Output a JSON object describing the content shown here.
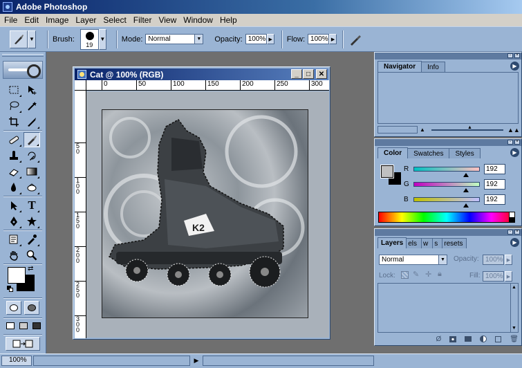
{
  "app": {
    "title": "Adobe Photoshop"
  },
  "menu": [
    "File",
    "Edit",
    "Image",
    "Layer",
    "Select",
    "Filter",
    "View",
    "Window",
    "Help"
  ],
  "options": {
    "brush_label": "Brush:",
    "brush_size": "19",
    "mode_label": "Mode:",
    "mode_value": "Normal",
    "opacity_label": "Opacity:",
    "opacity_value": "100%",
    "flow_label": "Flow:",
    "flow_value": "100%"
  },
  "document": {
    "title": "Cat @ 100% (RGB)",
    "ruler_h": [
      "0",
      "50",
      "100",
      "150",
      "200",
      "250",
      "300"
    ],
    "ruler_v": [
      "5\n0",
      "1\n0\n0",
      "1\n5\n0",
      "2\n0\n0",
      "2\n5\n0",
      "3\n0\n0"
    ]
  },
  "navigator": {
    "tabs": [
      "Navigator",
      "Info"
    ]
  },
  "color": {
    "tabs": [
      "Color",
      "Swatches",
      "Styles"
    ],
    "channels": [
      {
        "label": "R",
        "value": "192",
        "level": 0.75
      },
      {
        "label": "G",
        "value": "192",
        "level": 0.75
      },
      {
        "label": "B",
        "value": "192",
        "level": 0.75
      }
    ],
    "foreground": "#c0c0c0",
    "background": "#000000"
  },
  "layers": {
    "tabs": [
      "Layers",
      "els",
      "w",
      "s",
      "resets"
    ],
    "blend_mode": "Normal",
    "opacity_label": "Opacity:",
    "opacity_value": "100%",
    "lock_label": "Lock:",
    "fill_label": "Fill:",
    "fill_value": "100%"
  },
  "status": {
    "zoom": "100%"
  },
  "colors": {
    "panel": "#9ab4d4",
    "workspace": "#6f6f6f",
    "titlebar": "#0a246a"
  }
}
